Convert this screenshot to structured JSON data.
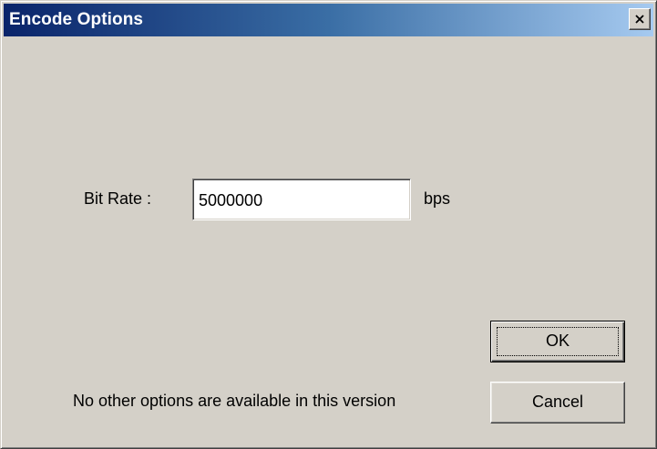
{
  "window": {
    "title": "Encode Options",
    "title_gradient_start": "#0a246a",
    "title_gradient_end": "#a6caf0",
    "background": "#d4d0c8"
  },
  "controls": {
    "close_icon": "close-icon",
    "bit_rate_label": "Bit Rate :",
    "bit_rate_value": "5000000",
    "bit_rate_unit": "bps",
    "ok_label": "OK",
    "cancel_label": "Cancel"
  },
  "footer": {
    "message": "No other options are available in this version"
  }
}
